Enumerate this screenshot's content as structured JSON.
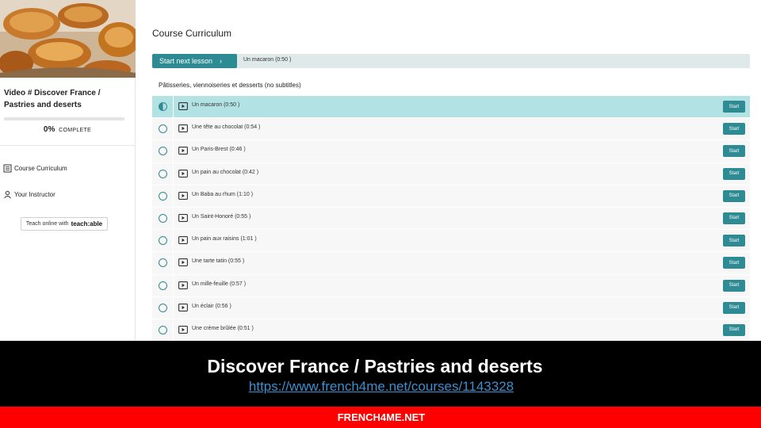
{
  "sidebar": {
    "course_title": "Video # Discover France / Pastries and deserts",
    "progress_percent": 0,
    "progress_label": "0%",
    "complete_label": "COMPLETE",
    "nav": [
      {
        "label": "Course Curriculum",
        "icon": "list-icon"
      },
      {
        "label": "Your Instructor",
        "icon": "person-icon"
      }
    ],
    "teach": {
      "prefix": "Teach online with",
      "brand": "teach:able"
    }
  },
  "main": {
    "title": "Course Curriculum",
    "next_button": "Start next lesson",
    "next_lesson": "Un macaron (0:50 )",
    "section_title": "Pâtisseries, viennoiseries et desserts (no subtitles)",
    "start_label": "Start",
    "lessons": [
      {
        "title": "Un macaron (0:50 )",
        "active": true
      },
      {
        "title": "Une tête au chocolat (0:54 )",
        "active": false
      },
      {
        "title": "Un Paris-Brest (0:46 )",
        "active": false
      },
      {
        "title": "Un pain au chocolat (0:42 )",
        "active": false
      },
      {
        "title": "Un Baba au rhum (1:10 )",
        "active": false
      },
      {
        "title": "Un Saint-Honoré (0:55 )",
        "active": false
      },
      {
        "title": "Un pain aux raisins (1:01 )",
        "active": false
      },
      {
        "title": "Une tarte tatin (0:55 )",
        "active": false
      },
      {
        "title": "Un mille-feuille (0:57 )",
        "active": false
      },
      {
        "title": "Un éclair (0:56 )",
        "active": false
      },
      {
        "title": "Une crème brûlée (0:51 )",
        "active": false
      }
    ]
  },
  "banner": {
    "title": "Discover France / Pastries and deserts",
    "url": "https://www.french4me.net/courses/1143328",
    "brand": "FRENCH4ME.NET"
  },
  "colors": {
    "accent": "#2e8b94",
    "active_row": "#b3e2e4",
    "banner_black": "#000000",
    "banner_red": "#ff0000"
  }
}
